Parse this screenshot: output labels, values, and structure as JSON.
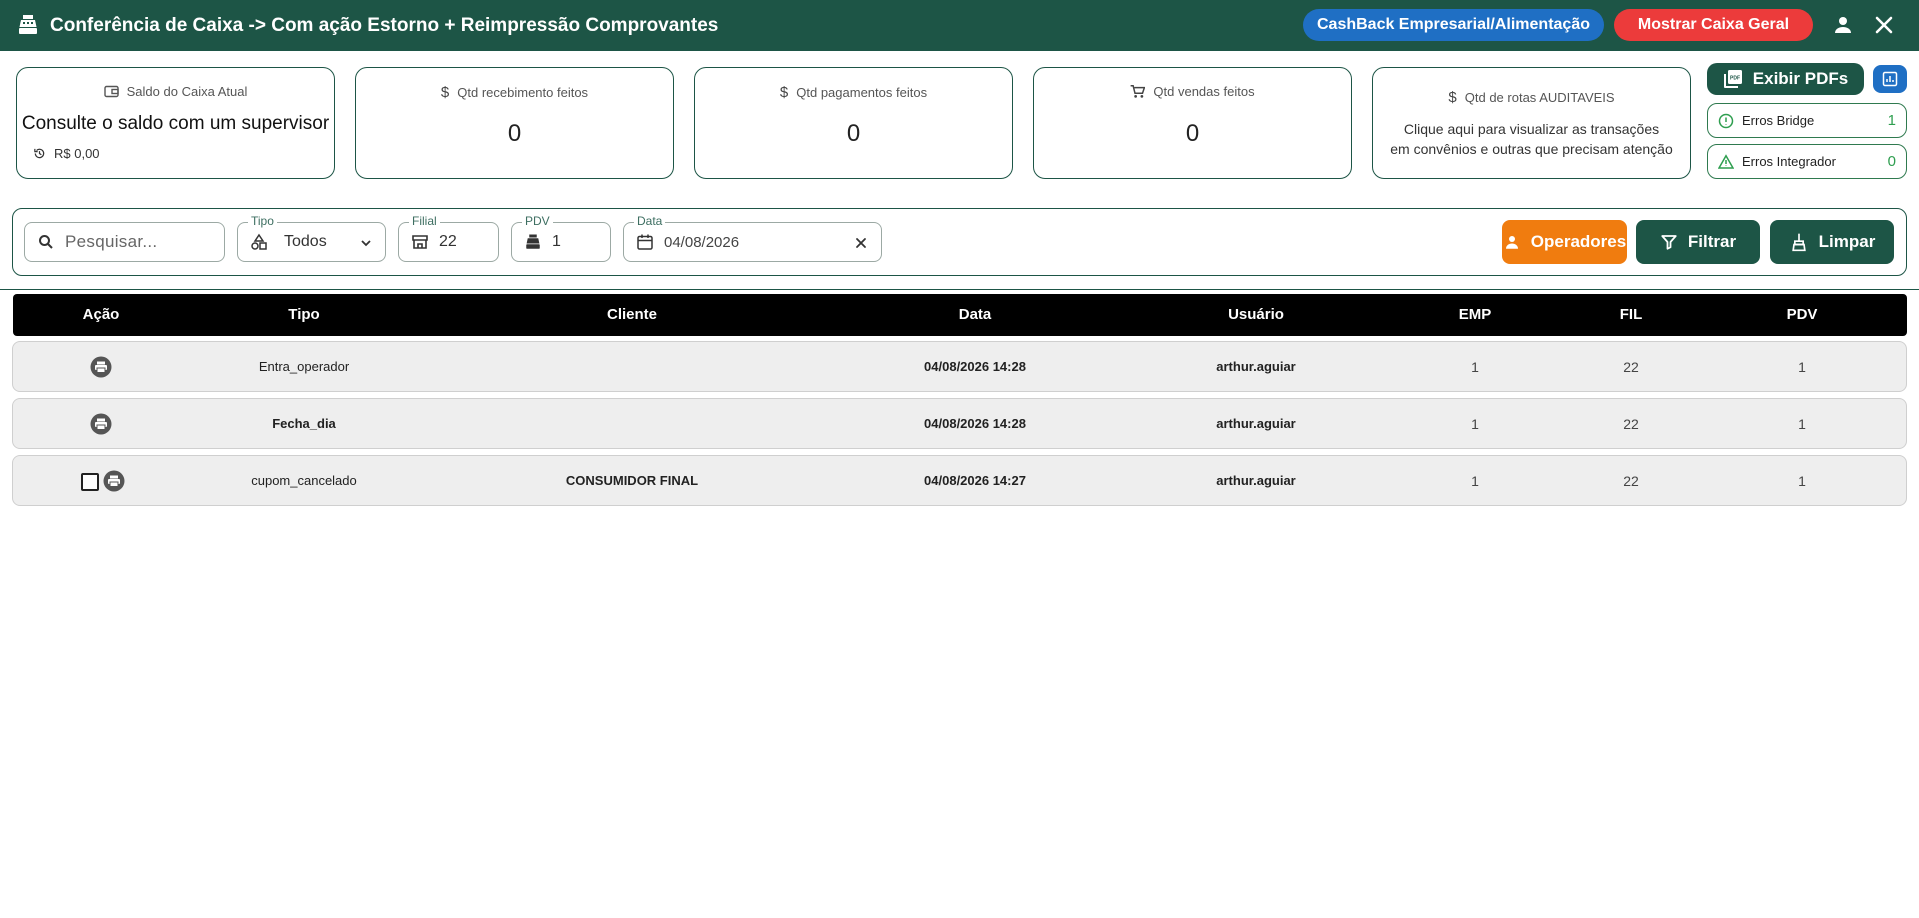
{
  "header": {
    "title": "Conferência de Caixa -> Com ação Estorno + Reimpressão Comprovantes",
    "logo_icon": "cash-register-icon",
    "cashback_label": "CashBack Empresarial/Alimentação",
    "caixa_geral_label": "Mostrar Caixa Geral",
    "user_icon": "person-icon",
    "close_icon": "close-icon",
    "colors": {
      "bar": "#1d5546",
      "cashback": "#1f6fc4",
      "caixa_geral": "#ec3b3b"
    }
  },
  "cards": {
    "saldo": {
      "label": "Saldo do Caixa Atual",
      "message": "Consulte o saldo com um supervisor",
      "amount": "R$ 0,00"
    },
    "recebimentos": {
      "label": "Qtd recebimento feitos",
      "value": "0"
    },
    "pagamentos": {
      "label": "Qtd pagamentos feitos",
      "value": "0"
    },
    "vendas": {
      "label": "Qtd vendas feitos",
      "value": "0"
    },
    "rotas": {
      "label": "Qtd de rotas AUDITAVEIS",
      "line1": "Clique aqui para visualizar as transações",
      "line2": "em convênios e outras que precisam atenção"
    }
  },
  "side": {
    "pdf_label": "Exibir PDFs",
    "erros_bridge": {
      "label": "Erros Bridge",
      "value": "1"
    },
    "erros_integrador": {
      "label": "Erros Integrador",
      "value": "0"
    }
  },
  "filters": {
    "search_placeholder": "Pesquisar...",
    "tipo": {
      "label": "Tipo",
      "value": "Todos"
    },
    "filial": {
      "label": "Filial",
      "value": "22"
    },
    "pdv": {
      "label": "PDV",
      "value": "1"
    },
    "data": {
      "label": "Data",
      "value": "04/08/2026"
    },
    "operadores_label": "Operadores",
    "filtrar_label": "Filtrar",
    "limpar_label": "Limpar",
    "colors": {
      "operadores": "#f07c0f",
      "primary": "#1d5546"
    }
  },
  "table": {
    "columns": [
      "Ação",
      "Tipo",
      "Cliente",
      "Data",
      "Usuário",
      "EMP",
      "FIL",
      "PDV"
    ],
    "rows": [
      {
        "tipo": "Entra_operador",
        "cliente": "",
        "data": "04/08/2026 14:28",
        "usuario": "arthur.aguiar",
        "emp": "1",
        "fil": "22",
        "pdv": "1"
      },
      {
        "tipo": "Fecha_dia",
        "cliente": "",
        "data": "04/08/2026 14:28",
        "usuario": "arthur.aguiar",
        "emp": "1",
        "fil": "22",
        "pdv": "1"
      },
      {
        "tipo": "cupom_cancelado",
        "cliente": "CONSUMIDOR FINAL",
        "data": "04/08/2026 14:27",
        "usuario": "arthur.aguiar",
        "emp": "1",
        "fil": "22",
        "pdv": "1"
      }
    ]
  }
}
